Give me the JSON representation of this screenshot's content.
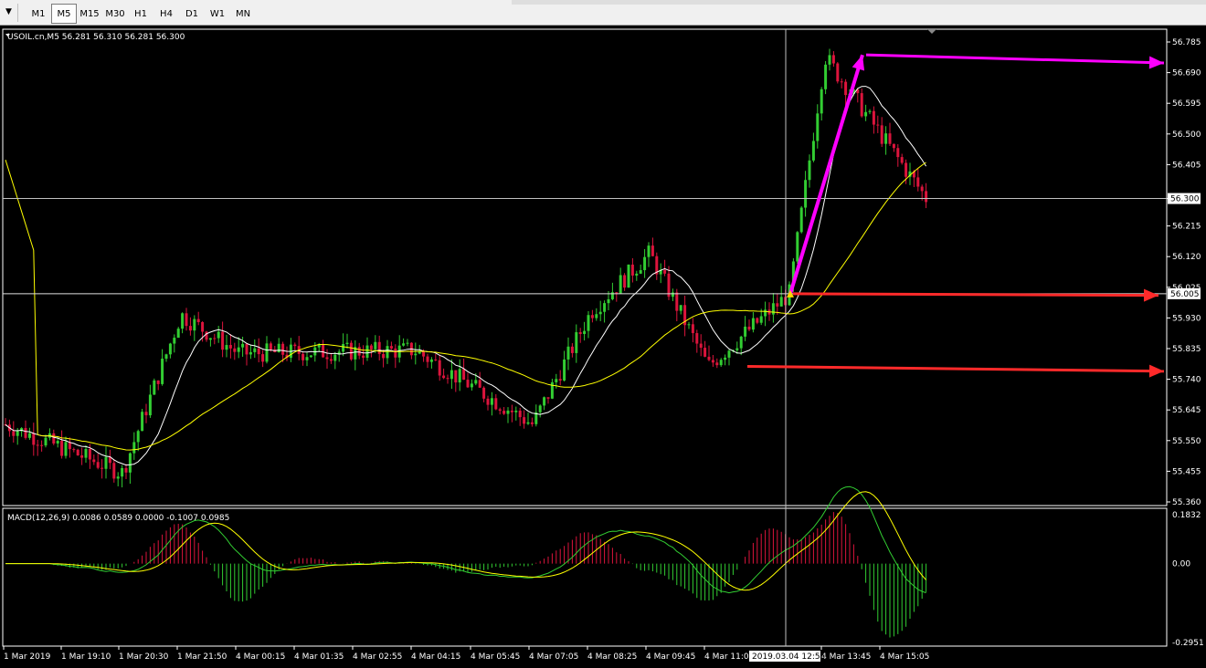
{
  "toolbar": {
    "timeframes": [
      "M1",
      "M5",
      "M15",
      "M30",
      "H1",
      "H4",
      "D1",
      "W1",
      "MN"
    ],
    "active": "M5"
  },
  "main_panel": {
    "header": "USOIL.cn,M5  56.281 56.310 56.281 56.300",
    "price_labels": [
      "56.785",
      "56.690",
      "56.595",
      "56.500",
      "56.405",
      "56.300",
      "56.215",
      "56.120",
      "56.025",
      "55.930",
      "55.835",
      "55.740",
      "55.645",
      "55.550",
      "55.455",
      "55.360"
    ],
    "current_price_tag": "56.300",
    "level_tag": "56.005"
  },
  "macd_panel": {
    "header": "MACD(12,26,9) 0.0086 0.0589 0.0000 -0.1007 0.0985",
    "labels": [
      "0.1832",
      "0.00",
      "-0.2951"
    ]
  },
  "time_axis": {
    "labels": [
      "1 Mar 2019",
      "1 Mar 19:10",
      "1 Mar 20:30",
      "1 Mar 21:50",
      "4 Mar 00:15",
      "4 Mar 01:35",
      "4 Mar 02:55",
      "4 Mar 04:15",
      "4 Mar 05:45",
      "4 Mar 07:05",
      "4 Mar 08:25",
      "4 Mar 09:45",
      "4 Mar 11:05",
      "4 Mar 13:45",
      "4 Mar 15:05"
    ],
    "crosshair_tag": "2019.03.04 12:55"
  },
  "colors": {
    "bull": "#32cd32",
    "bear": "#dc143c",
    "ma_fast": "#ffffff",
    "ma_slow": "#ffff00",
    "arrow_up": "#ff00ff",
    "arrow_level": "#ff2a2a"
  },
  "chart_data": {
    "type": "candlestick",
    "symbol": "USOIL.cn",
    "timeframe": "M5",
    "ylim": [
      55.36,
      56.785
    ],
    "key_points": [
      {
        "x": "1 Mar 2019",
        "y": 55.6
      },
      {
        "x": "1 Mar 20:30",
        "y": 55.45
      },
      {
        "x": "1 Mar 21:50",
        "y": 55.94
      },
      {
        "x": "4 Mar 00:15",
        "y": 55.82
      },
      {
        "x": "4 Mar 04:15",
        "y": 55.83
      },
      {
        "x": "4 Mar 07:05",
        "y": 55.6
      },
      {
        "x": "4 Mar 08:25",
        "y": 55.95
      },
      {
        "x": "4 Mar 09:45",
        "y": 56.13
      },
      {
        "x": "4 Mar 11:05",
        "y": 55.78
      },
      {
        "x": "2019.03.04 12:55",
        "y": 56.005
      },
      {
        "x": "4 Mar 13:45",
        "y": 56.74
      },
      {
        "x": "4 Mar 15:05",
        "y": 56.3
      }
    ],
    "horizontal_levels": [
      56.3,
      56.005,
      55.78
    ],
    "macd_ylim": [
      -0.2951,
      0.1832
    ]
  }
}
